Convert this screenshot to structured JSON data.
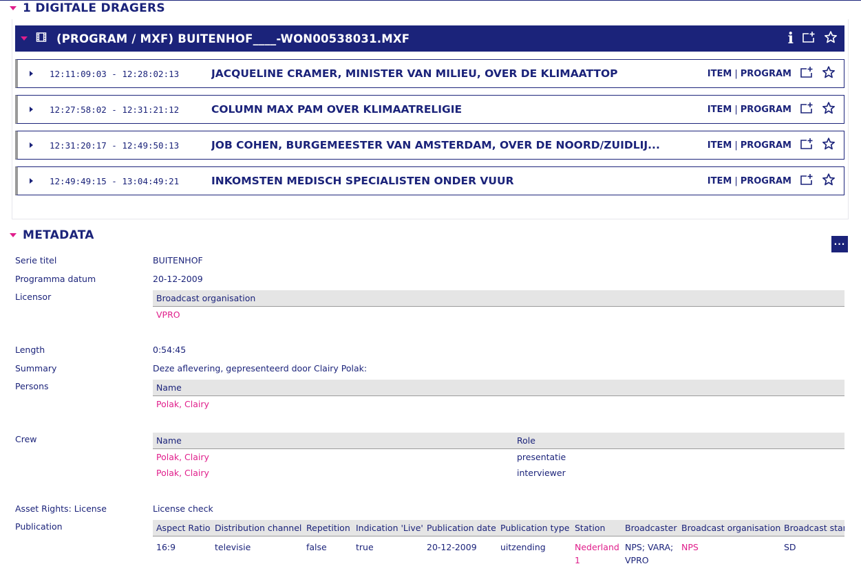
{
  "carriers_section": {
    "title": "1 DIGITALE DRAGERS"
  },
  "carrier": {
    "title": "(PROGRAM / MXF) BUITENHOF____-WON00538031.MXF",
    "info_label": "i"
  },
  "items": [
    {
      "timecode": "12:11:09:03 - 12:28:02:13",
      "title": "JACQUELINE CRAMER, MINISTER VAN MILIEU, OVER DE KLIMAATTOP",
      "link_item": "ITEM",
      "link_sep": "|",
      "link_program": "PROGRAM"
    },
    {
      "timecode": "12:27:58:02 - 12:31:21:12",
      "title": "COLUMN MAX PAM OVER KLIMAATRELIGIE",
      "link_item": "ITEM",
      "link_sep": "|",
      "link_program": "PROGRAM"
    },
    {
      "timecode": "12:31:20:17 - 12:49:50:13",
      "title": "JOB COHEN, BURGEMEESTER VAN AMSTERDAM, OVER DE NOORD/ZUIDLIJ...",
      "link_item": "ITEM",
      "link_sep": "|",
      "link_program": "PROGRAM"
    },
    {
      "timecode": "12:49:49:15 - 13:04:49:21",
      "title": "INKOMSTEN MEDISCH SPECIALISTEN ONDER VUUR",
      "link_item": "ITEM",
      "link_sep": "|",
      "link_program": "PROGRAM"
    }
  ],
  "metadata_section": {
    "title": "METADATA",
    "more_label": "···"
  },
  "metadata": {
    "serie_titel": {
      "label": "Serie titel",
      "value": "BUITENHOF"
    },
    "programma_datum": {
      "label": "Programma datum",
      "value": "20-12-2009"
    },
    "licensor": {
      "label": "Licensor",
      "header": "Broadcast organisation",
      "value": "VPRO"
    },
    "length": {
      "label": "Length",
      "value": "0:54:45"
    },
    "summary": {
      "label": "Summary",
      "value": "Deze aflevering, gepresenteerd door Clairy Polak:"
    },
    "persons": {
      "label": "Persons",
      "header": "Name",
      "value": "Polak, Clairy"
    },
    "crew": {
      "label": "Crew",
      "headers": [
        "Name",
        "Role"
      ],
      "rows": [
        {
          "name": "Polak, Clairy",
          "role": "presentatie"
        },
        {
          "name": "Polak, Clairy",
          "role": "interviewer"
        }
      ]
    },
    "asset_rights": {
      "label": "Asset Rights: License",
      "value": "License check"
    },
    "publication": {
      "label": "Publication",
      "headers": [
        "Aspect Ratio",
        "Distribution channel",
        "Repetition",
        "Indication 'Live'",
        "Publication date",
        "Publication type",
        "Station",
        "Broadcaster",
        "Broadcast organisation",
        "Broadcast stan"
      ],
      "row": {
        "aspect_ratio": "16:9",
        "distribution_channel": "televisie",
        "repetition": "false",
        "indication_live": "true",
        "publication_date": "20-12-2009",
        "publication_type": "uitzending",
        "station_line1": "Nederland",
        "station_line2": "1",
        "broadcaster_line1": "NPS; VARA;",
        "broadcaster_line2": "VPRO",
        "broadcast_organisation": "NPS",
        "broadcast_standard": "SD"
      }
    }
  },
  "colors": {
    "navy": "#1b237a",
    "accent": "#e01e8b",
    "grey_header": "#e5e5e5"
  },
  "icons": [
    "caret-down-icon",
    "caret-right-icon",
    "film-icon",
    "info-icon",
    "add-to-folder-icon",
    "star-icon",
    "more-icon"
  ]
}
